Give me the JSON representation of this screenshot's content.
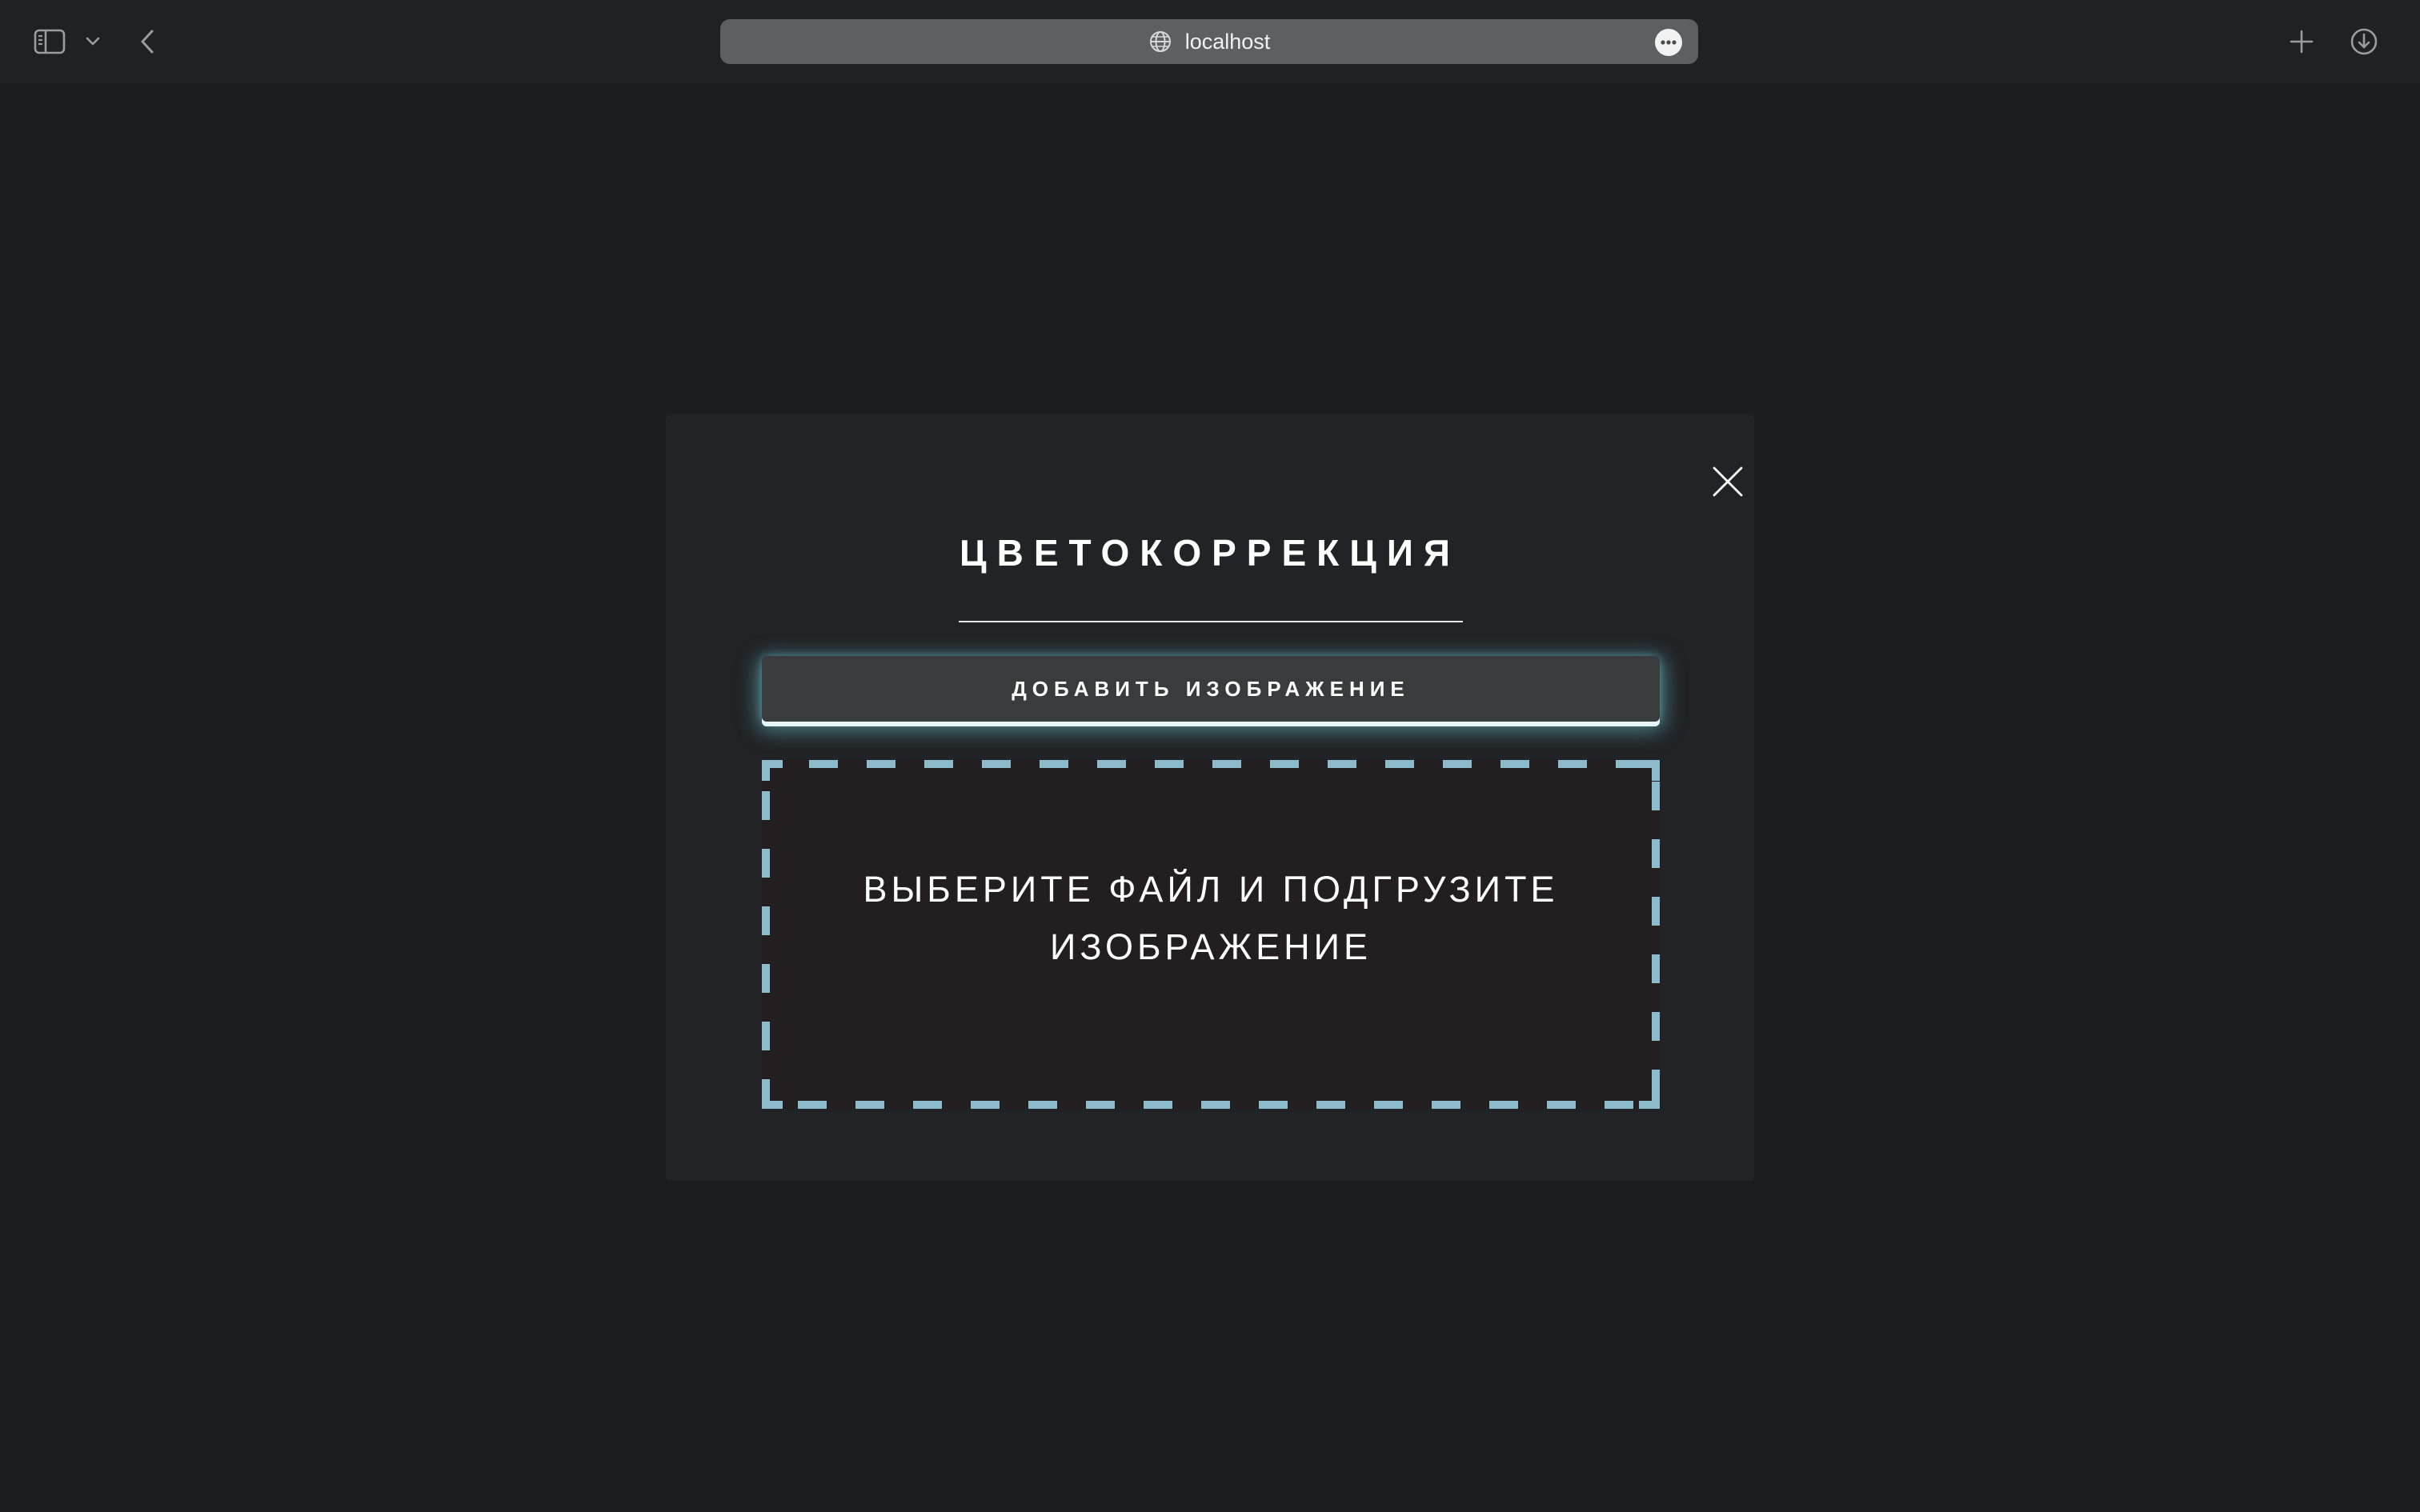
{
  "browser": {
    "url": "localhost",
    "icons": {
      "sidebar": "sidebar-icon",
      "sidebar_menu": "chevron-down-icon",
      "back": "chevron-left-icon",
      "site": "globe-icon",
      "page_menu": "ellipsis-icon",
      "new_tab": "plus-icon",
      "downloads": "download-icon"
    }
  },
  "modal": {
    "title": "ЦВЕТОКОРРЕКЦИЯ",
    "close_icon": "close-icon",
    "add_button_label": "ДОБАВИТЬ ИЗОБРАЖЕНИЕ",
    "dropzone_line1": "ВЫБЕРИТЕ ФАЙЛ И ПОДГРУЗИТЕ",
    "dropzone_line2": "ИЗОБРАЖЕНИЕ"
  },
  "colors": {
    "page_background": "#1b1d20",
    "toolbar_background": "#1f2124",
    "address_bar": "#5d5f62",
    "modal_background": "#212326",
    "button_background": "#3a3b3c",
    "button_glow": "#78dee6",
    "dropzone_background": "#231f20",
    "dropzone_dash": "#8cbccb",
    "text": "#ffffff"
  }
}
